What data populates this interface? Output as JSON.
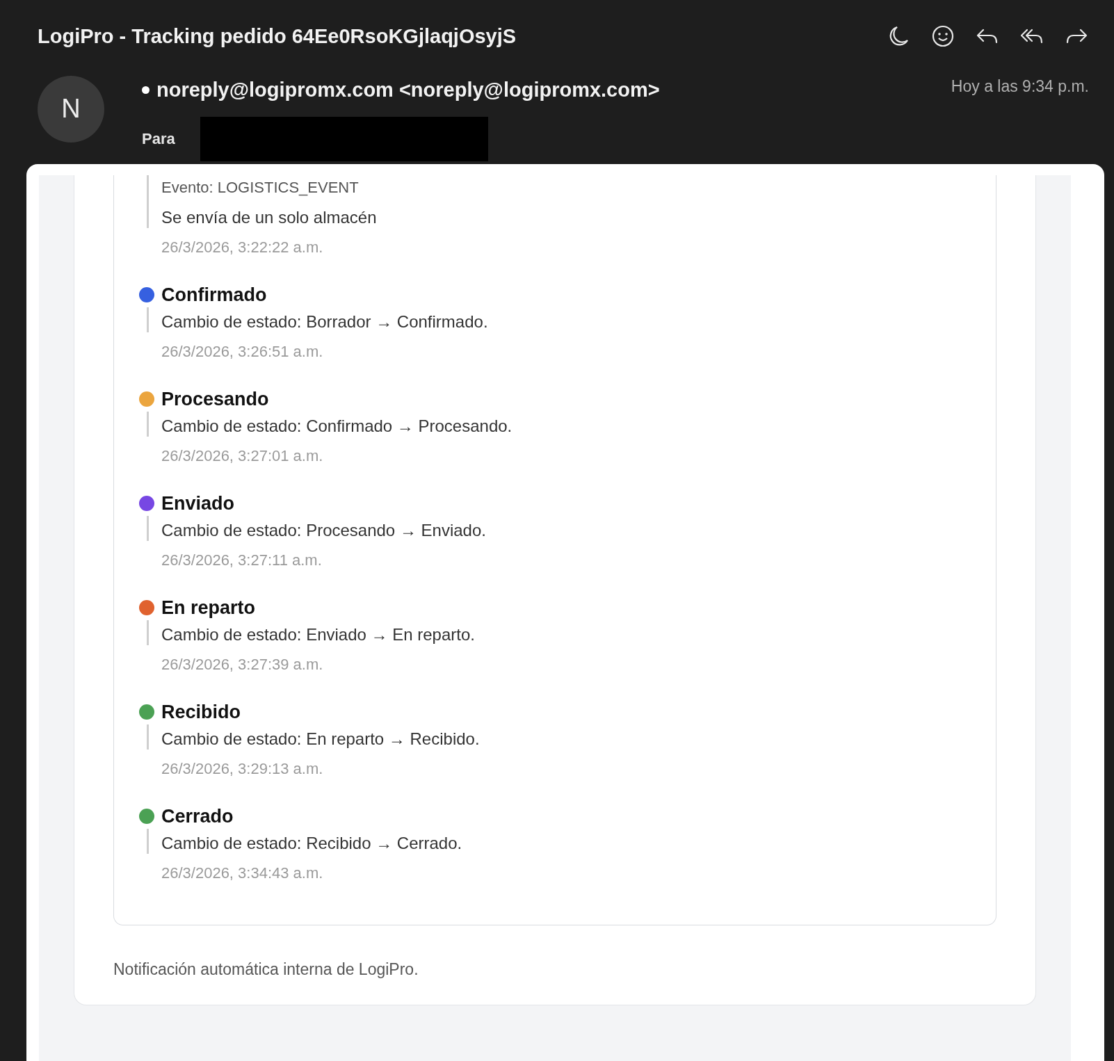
{
  "header": {
    "subject": "LogiPro - Tracking pedido 64Ee0RsoKGjlaqjOsyjS",
    "avatar_initial": "N",
    "sender": "noreply@logipromx.com <noreply@logipromx.com>",
    "unread": true,
    "to_label": "Para",
    "time": "Hoy a las 9:34 p.m."
  },
  "timeline": [
    {
      "kind": "note",
      "lines": [
        "Evento: LOGISTICS_EVENT",
        "Se envía de un solo almacén"
      ],
      "date": "26/3/2026, 3:22:22 a.m."
    },
    {
      "kind": "status",
      "title": "Confirmado",
      "color": "#3660e0",
      "description": "Cambio de estado: Borrador → Confirmado.",
      "date": "26/3/2026, 3:26:51 a.m."
    },
    {
      "kind": "status",
      "title": "Procesando",
      "color": "#eba53e",
      "description": "Cambio de estado: Confirmado → Procesando.",
      "date": "26/3/2026, 3:27:01 a.m."
    },
    {
      "kind": "status",
      "title": "Enviado",
      "color": "#7747e3",
      "description": "Cambio de estado: Procesando → Enviado.",
      "date": "26/3/2026, 3:27:11 a.m."
    },
    {
      "kind": "status",
      "title": "En reparto",
      "color": "#e0622f",
      "description": "Cambio de estado: Enviado → En reparto.",
      "date": "26/3/2026, 3:27:39 a.m."
    },
    {
      "kind": "status",
      "title": "Recibido",
      "color": "#4ba154",
      "description": "Cambio de estado: En reparto → Recibido.",
      "date": "26/3/2026, 3:29:13 a.m."
    },
    {
      "kind": "status",
      "title": "Cerrado",
      "color": "#4ba154",
      "description": "Cambio de estado: Recibido → Cerrado.",
      "date": "26/3/2026, 3:34:43 a.m."
    }
  ],
  "footer": "Notificación automática interna de LogiPro."
}
